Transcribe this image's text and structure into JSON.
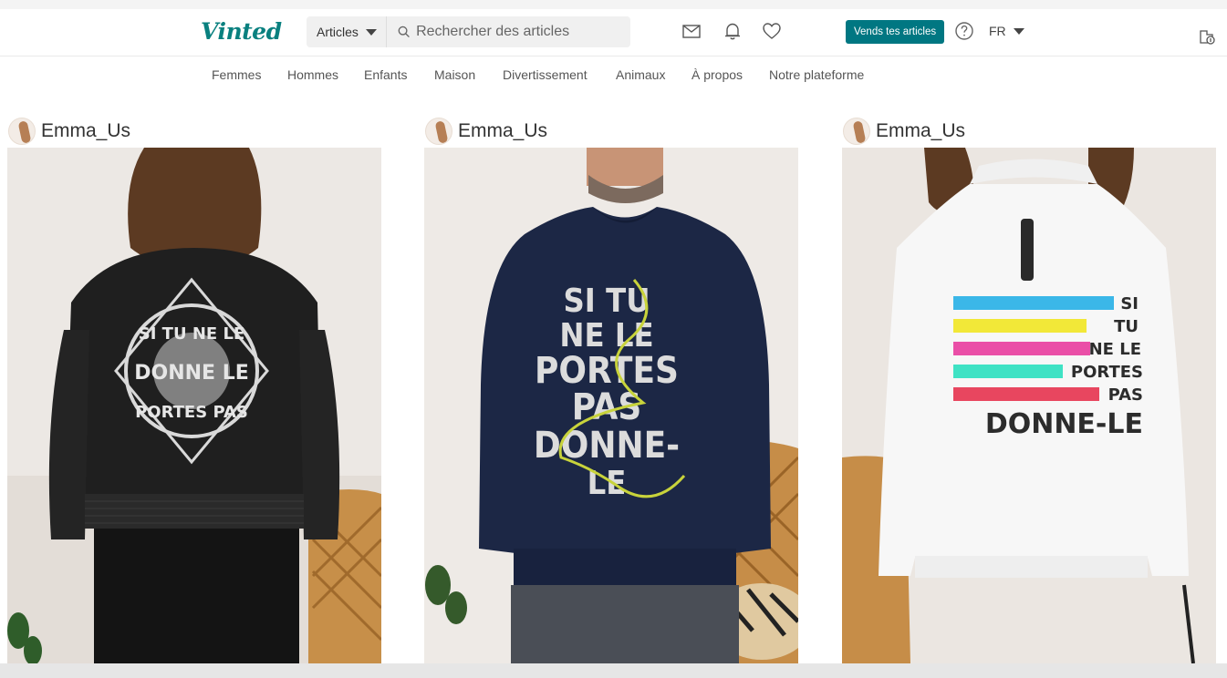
{
  "brand": {
    "logo_text": "Vinted",
    "accent": "#09807f"
  },
  "search": {
    "category": "Articles",
    "placeholder": "Rechercher des articles"
  },
  "header": {
    "sell_label": "Vends tes articles",
    "language": "FR"
  },
  "icons": [
    "mail-icon",
    "bell-icon",
    "heart-icon",
    "help-icon",
    "extension-icon"
  ],
  "categories": [
    "Femmes",
    "Hommes",
    "Enfants",
    "Maison",
    "Divertissement",
    "Animaux",
    "À propos",
    "Notre plateforme"
  ],
  "items": [
    {
      "seller": "Emma_Us"
    },
    {
      "seller": "Emma_Us"
    },
    {
      "seller": "Emma_Us"
    }
  ],
  "prints": {
    "jacket_lines": [
      "SI TU NE LE",
      "DONNE LE",
      "PORTES PAS"
    ],
    "sweater_lines": [
      "SI TU",
      "NE LE",
      "PORTES",
      "PAS",
      "DONNE-",
      "LE"
    ],
    "windbreaker_lines": [
      "SI",
      "TU",
      "NE LE",
      "PORTES",
      "PAS",
      "DONNE-LE"
    ]
  }
}
